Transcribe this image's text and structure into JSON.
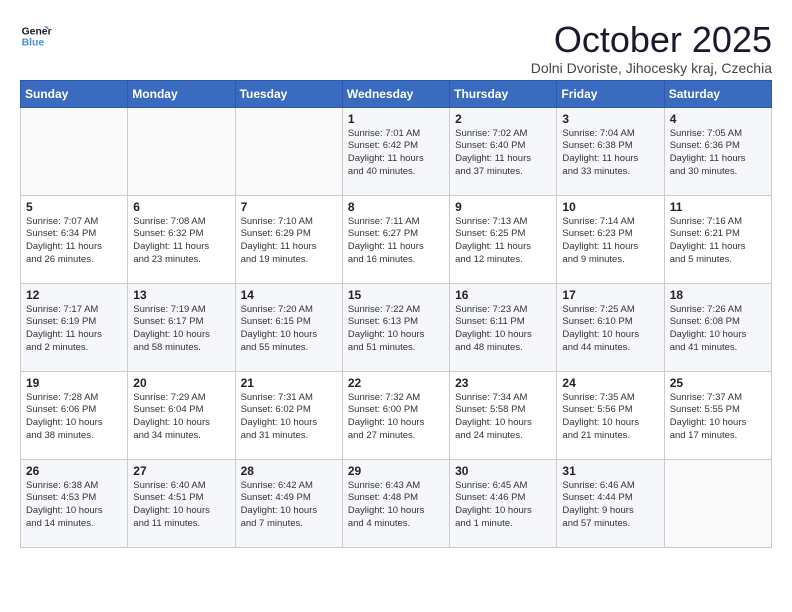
{
  "logo": {
    "line1": "General",
    "line2": "Blue"
  },
  "header": {
    "month": "October 2025",
    "location": "Dolni Dvoriste, Jihocesky kraj, Czechia"
  },
  "weekdays": [
    "Sunday",
    "Monday",
    "Tuesday",
    "Wednesday",
    "Thursday",
    "Friday",
    "Saturday"
  ],
  "weeks": [
    [
      {
        "day": "",
        "info": ""
      },
      {
        "day": "",
        "info": ""
      },
      {
        "day": "",
        "info": ""
      },
      {
        "day": "1",
        "info": "Sunrise: 7:01 AM\nSunset: 6:42 PM\nDaylight: 11 hours\nand 40 minutes."
      },
      {
        "day": "2",
        "info": "Sunrise: 7:02 AM\nSunset: 6:40 PM\nDaylight: 11 hours\nand 37 minutes."
      },
      {
        "day": "3",
        "info": "Sunrise: 7:04 AM\nSunset: 6:38 PM\nDaylight: 11 hours\nand 33 minutes."
      },
      {
        "day": "4",
        "info": "Sunrise: 7:05 AM\nSunset: 6:36 PM\nDaylight: 11 hours\nand 30 minutes."
      }
    ],
    [
      {
        "day": "5",
        "info": "Sunrise: 7:07 AM\nSunset: 6:34 PM\nDaylight: 11 hours\nand 26 minutes."
      },
      {
        "day": "6",
        "info": "Sunrise: 7:08 AM\nSunset: 6:32 PM\nDaylight: 11 hours\nand 23 minutes."
      },
      {
        "day": "7",
        "info": "Sunrise: 7:10 AM\nSunset: 6:29 PM\nDaylight: 11 hours\nand 19 minutes."
      },
      {
        "day": "8",
        "info": "Sunrise: 7:11 AM\nSunset: 6:27 PM\nDaylight: 11 hours\nand 16 minutes."
      },
      {
        "day": "9",
        "info": "Sunrise: 7:13 AM\nSunset: 6:25 PM\nDaylight: 11 hours\nand 12 minutes."
      },
      {
        "day": "10",
        "info": "Sunrise: 7:14 AM\nSunset: 6:23 PM\nDaylight: 11 hours\nand 9 minutes."
      },
      {
        "day": "11",
        "info": "Sunrise: 7:16 AM\nSunset: 6:21 PM\nDaylight: 11 hours\nand 5 minutes."
      }
    ],
    [
      {
        "day": "12",
        "info": "Sunrise: 7:17 AM\nSunset: 6:19 PM\nDaylight: 11 hours\nand 2 minutes."
      },
      {
        "day": "13",
        "info": "Sunrise: 7:19 AM\nSunset: 6:17 PM\nDaylight: 10 hours\nand 58 minutes."
      },
      {
        "day": "14",
        "info": "Sunrise: 7:20 AM\nSunset: 6:15 PM\nDaylight: 10 hours\nand 55 minutes."
      },
      {
        "day": "15",
        "info": "Sunrise: 7:22 AM\nSunset: 6:13 PM\nDaylight: 10 hours\nand 51 minutes."
      },
      {
        "day": "16",
        "info": "Sunrise: 7:23 AM\nSunset: 6:11 PM\nDaylight: 10 hours\nand 48 minutes."
      },
      {
        "day": "17",
        "info": "Sunrise: 7:25 AM\nSunset: 6:10 PM\nDaylight: 10 hours\nand 44 minutes."
      },
      {
        "day": "18",
        "info": "Sunrise: 7:26 AM\nSunset: 6:08 PM\nDaylight: 10 hours\nand 41 minutes."
      }
    ],
    [
      {
        "day": "19",
        "info": "Sunrise: 7:28 AM\nSunset: 6:06 PM\nDaylight: 10 hours\nand 38 minutes."
      },
      {
        "day": "20",
        "info": "Sunrise: 7:29 AM\nSunset: 6:04 PM\nDaylight: 10 hours\nand 34 minutes."
      },
      {
        "day": "21",
        "info": "Sunrise: 7:31 AM\nSunset: 6:02 PM\nDaylight: 10 hours\nand 31 minutes."
      },
      {
        "day": "22",
        "info": "Sunrise: 7:32 AM\nSunset: 6:00 PM\nDaylight: 10 hours\nand 27 minutes."
      },
      {
        "day": "23",
        "info": "Sunrise: 7:34 AM\nSunset: 5:58 PM\nDaylight: 10 hours\nand 24 minutes."
      },
      {
        "day": "24",
        "info": "Sunrise: 7:35 AM\nSunset: 5:56 PM\nDaylight: 10 hours\nand 21 minutes."
      },
      {
        "day": "25",
        "info": "Sunrise: 7:37 AM\nSunset: 5:55 PM\nDaylight: 10 hours\nand 17 minutes."
      }
    ],
    [
      {
        "day": "26",
        "info": "Sunrise: 6:38 AM\nSunset: 4:53 PM\nDaylight: 10 hours\nand 14 minutes."
      },
      {
        "day": "27",
        "info": "Sunrise: 6:40 AM\nSunset: 4:51 PM\nDaylight: 10 hours\nand 11 minutes."
      },
      {
        "day": "28",
        "info": "Sunrise: 6:42 AM\nSunset: 4:49 PM\nDaylight: 10 hours\nand 7 minutes."
      },
      {
        "day": "29",
        "info": "Sunrise: 6:43 AM\nSunset: 4:48 PM\nDaylight: 10 hours\nand 4 minutes."
      },
      {
        "day": "30",
        "info": "Sunrise: 6:45 AM\nSunset: 4:46 PM\nDaylight: 10 hours\nand 1 minute."
      },
      {
        "day": "31",
        "info": "Sunrise: 6:46 AM\nSunset: 4:44 PM\nDaylight: 9 hours\nand 57 minutes."
      },
      {
        "day": "",
        "info": ""
      }
    ]
  ]
}
